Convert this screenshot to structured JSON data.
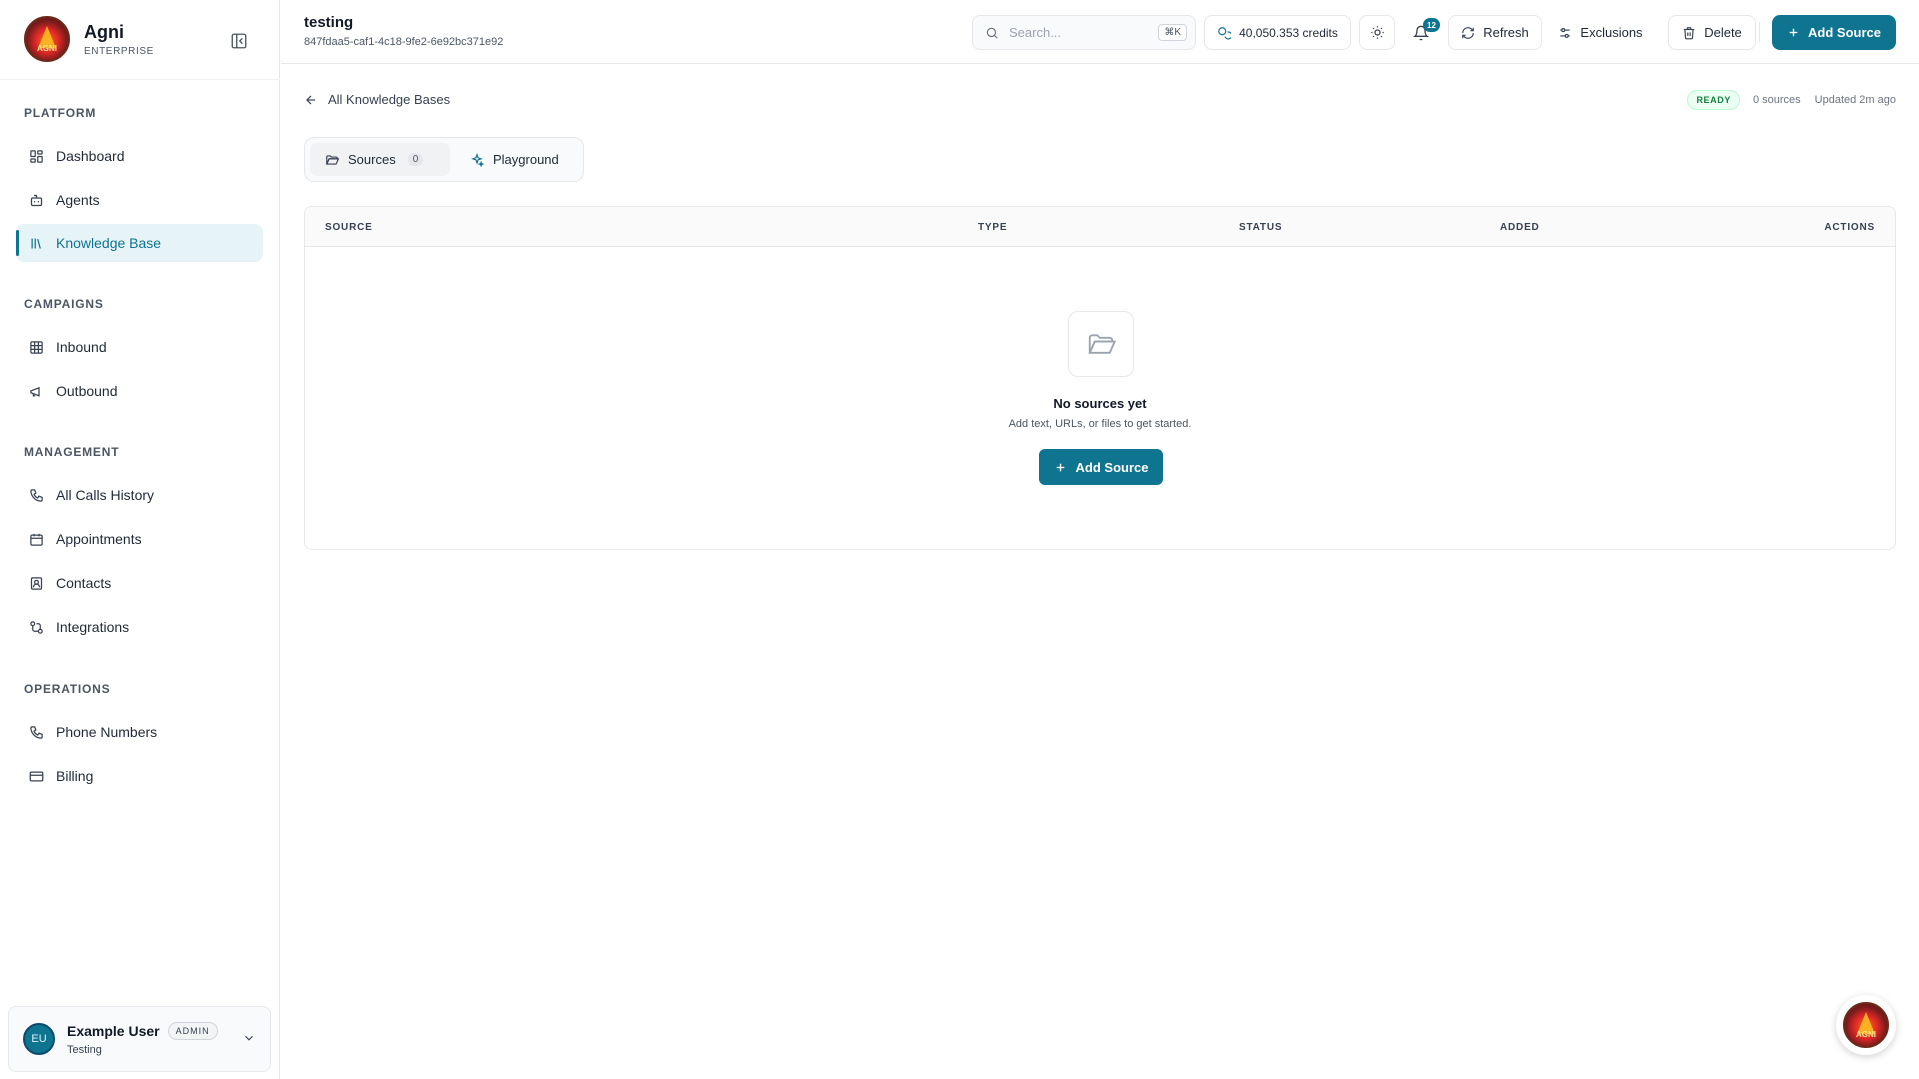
{
  "brand": {
    "name": "Agni",
    "tier": "ENTERPRISE",
    "logo_text": "AGNI"
  },
  "sidebar": {
    "sections": {
      "platform": "PLATFORM",
      "campaigns": "CAMPAIGNS",
      "management": "MANAGEMENT",
      "operations": "OPERATIONS"
    },
    "items": {
      "dashboard": "Dashboard",
      "agents": "Agents",
      "knowledge_base": "Knowledge Base",
      "inbound": "Inbound",
      "outbound": "Outbound",
      "calls_history": "All Calls History",
      "appointments": "Appointments",
      "contacts": "Contacts",
      "integrations": "Integrations",
      "phone_numbers": "Phone Numbers",
      "billing": "Billing"
    },
    "active_item": "Knowledge Base"
  },
  "user": {
    "initials": "EU",
    "name": "Example User",
    "role": "ADMIN",
    "org": "Testing"
  },
  "header": {
    "title": "testing",
    "id": "847fdaa5-caf1-4c18-9fe2-6e92bc371e92",
    "search_placeholder": "Search...",
    "search_shortcut": "⌘K",
    "credits": "40,050.353 credits",
    "notifications_count": "12",
    "refresh_label": "Refresh",
    "exclusions_label": "Exclusions",
    "delete_label": "Delete",
    "add_source_label": "Add Source"
  },
  "main": {
    "back_label": "All Knowledge Bases",
    "status_badge": "READY",
    "sources_count": "0 sources",
    "updated": "Updated 2m ago",
    "tabs": {
      "sources_label": "Sources",
      "sources_count": "0",
      "playground_label": "Playground"
    },
    "table": {
      "columns": {
        "source": "SOURCE",
        "type": "TYPE",
        "status": "STATUS",
        "added": "ADDED",
        "actions": "ACTIONS"
      }
    },
    "empty": {
      "title": "No sources yet",
      "subtitle": "Add text, URLs, or files to get started.",
      "button_label": "Add Source"
    }
  },
  "colors": {
    "accent": "#0e7490",
    "ready": "#15803d"
  }
}
